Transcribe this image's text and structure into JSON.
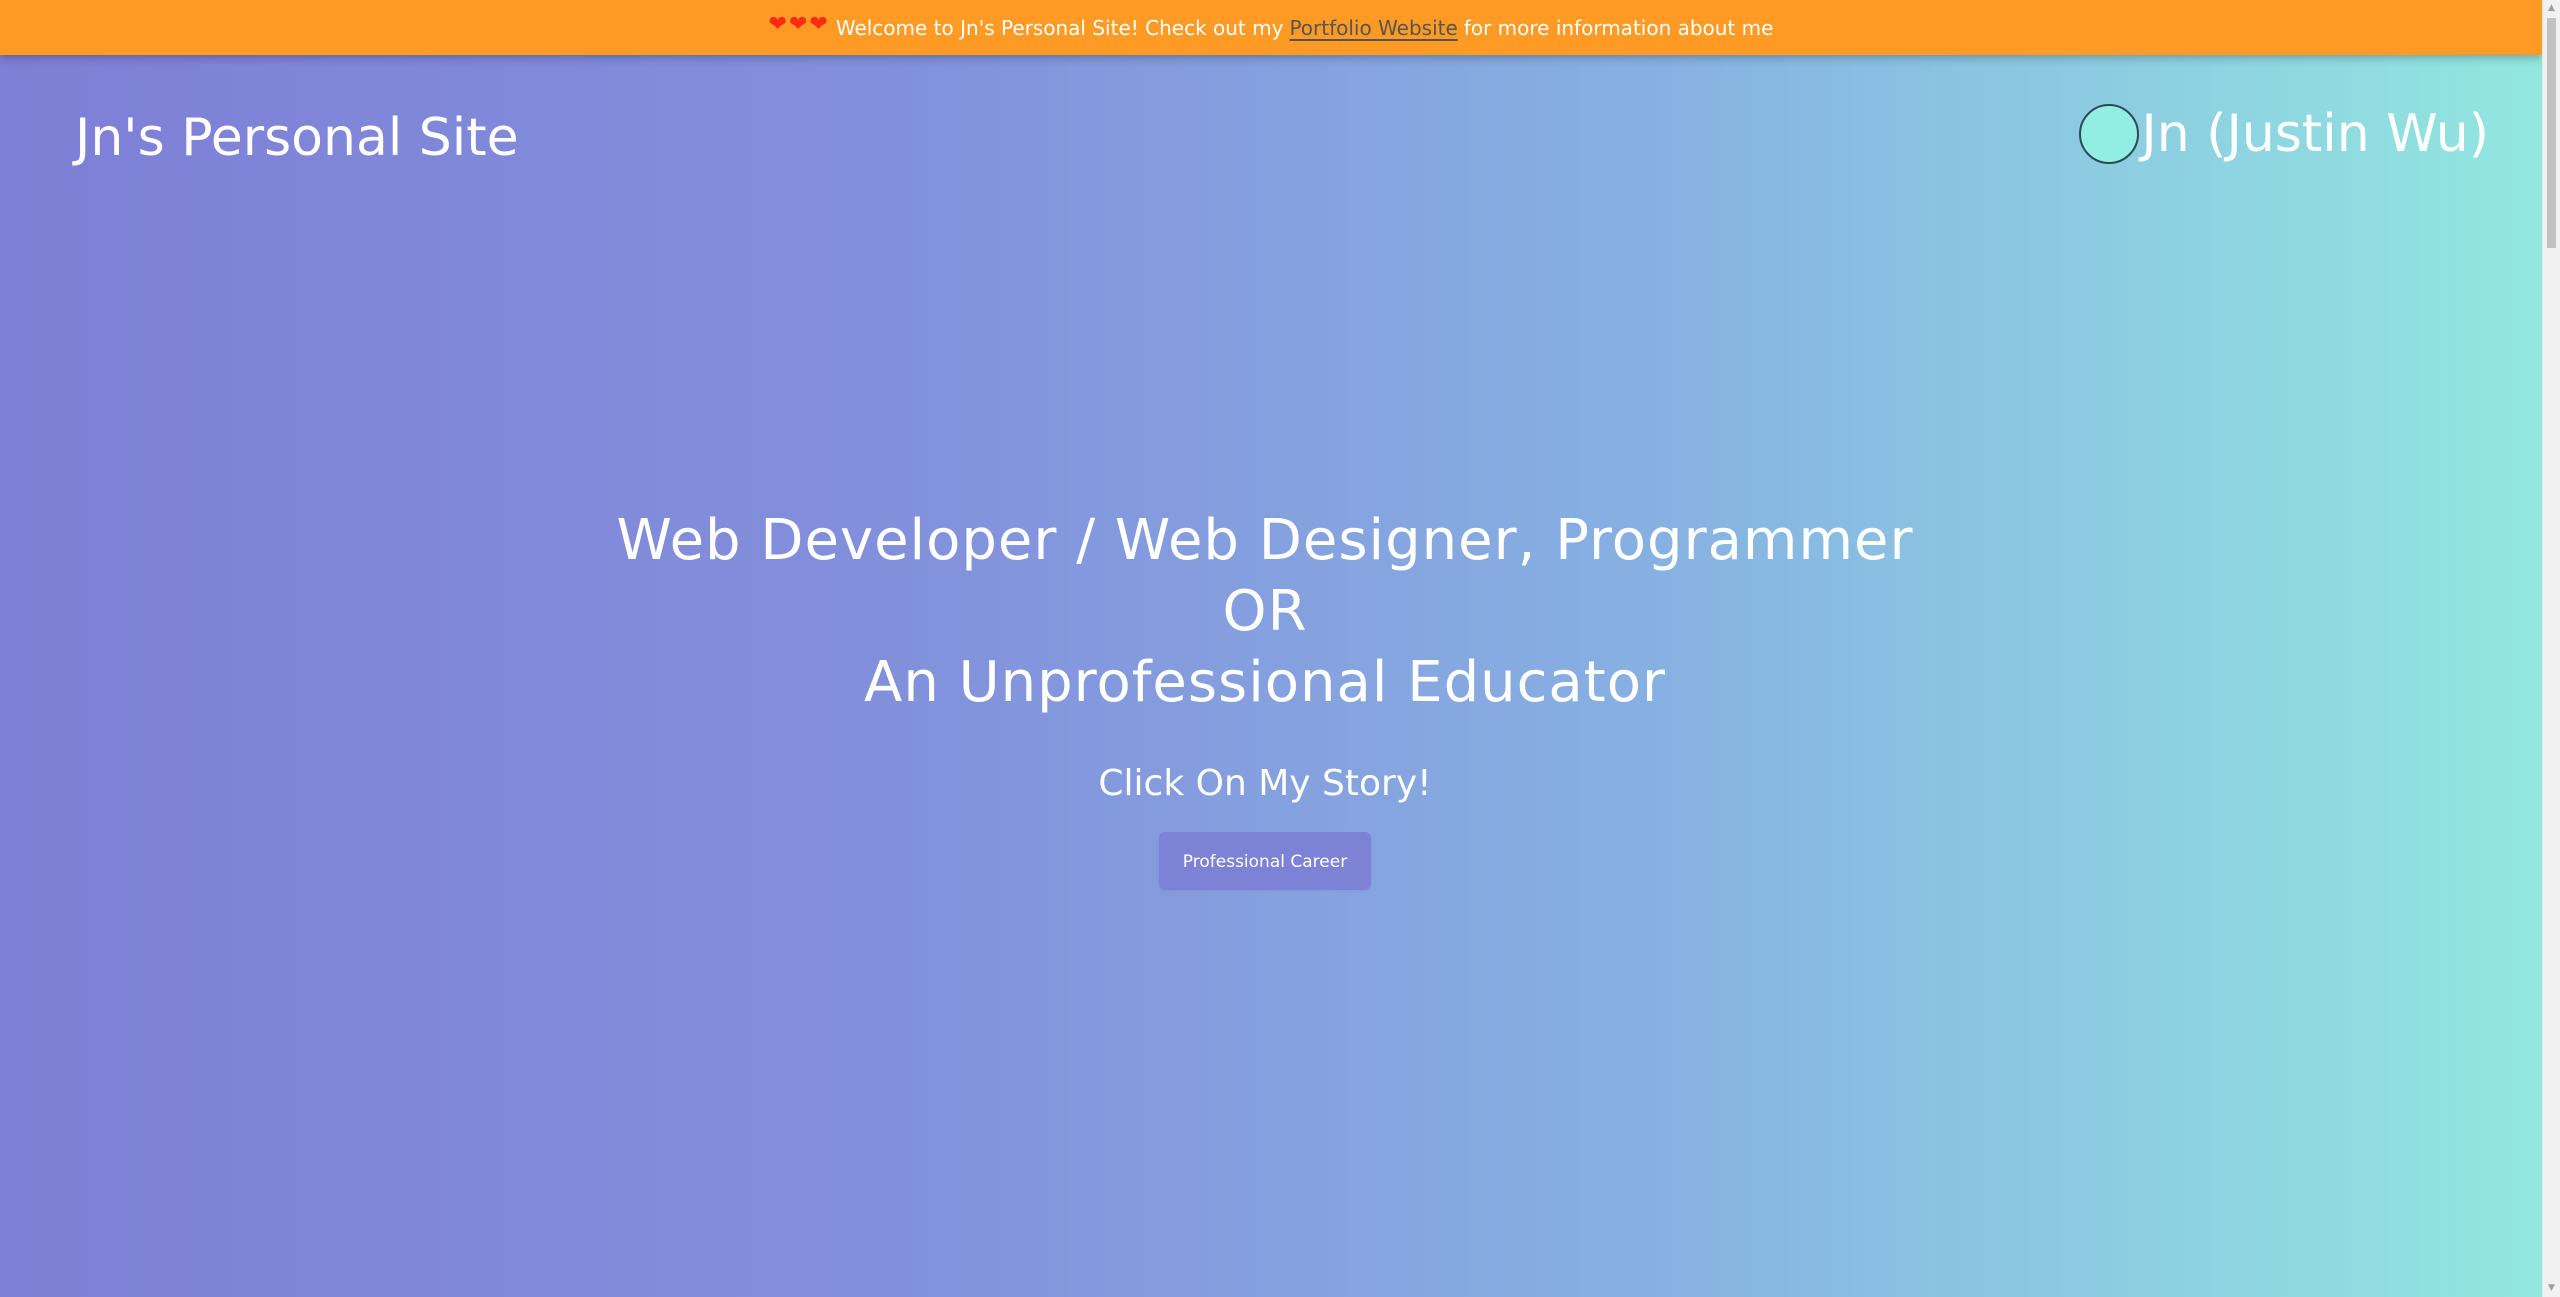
{
  "banner": {
    "hearts": [
      "❤",
      "❤",
      "❤"
    ],
    "text_before": "Welcome to Jn's Personal Site! Check out my",
    "link_text": "Portfolio Website",
    "text_after": "for more information about me",
    "background_color": "#ff9a24",
    "heart_color": "#ff2a10"
  },
  "header": {
    "site_title": "Jn's Personal Site",
    "user_name": "Jn (Justin Wu)",
    "avatar_color": "#92ede2"
  },
  "hero": {
    "line1": "Web Developer / Web Designer, Programmer",
    "line2": "OR",
    "line3": "An Unprofessional Educator",
    "subtitle": "Click On My Story!",
    "button_label": "Professional Career"
  },
  "colors": {
    "gradient_start": "#7e7fd6",
    "gradient_end": "#92e8e0",
    "button_bg": "#7d82d6"
  },
  "icons": {
    "heart": "heart-icon",
    "scroll_up": "scroll-up-arrow-icon",
    "scroll_down": "scroll-down-arrow-icon"
  }
}
